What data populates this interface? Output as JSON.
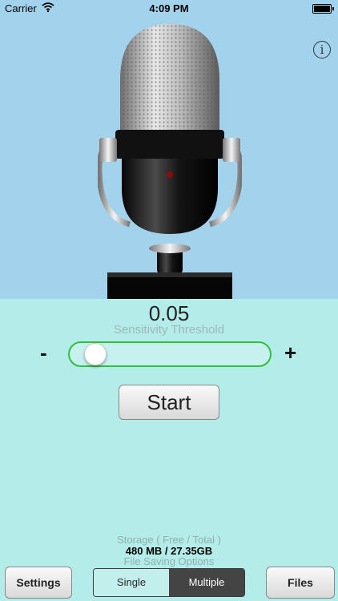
{
  "status": {
    "carrier": "Carrier",
    "time": "4:09 PM"
  },
  "header": {
    "info_icon": "info-icon",
    "mic_image": "microphone-illustration"
  },
  "sensitivity": {
    "value": "0.05",
    "label": "Sensitivity Threshold",
    "minus": "-",
    "plus": "+",
    "slider_fraction": 0.05
  },
  "actions": {
    "start_label": "Start"
  },
  "storage": {
    "label": "Storage ( Free / Total )",
    "value": "480 MB / 27.35GB"
  },
  "file_saving": {
    "label": "File Saving Options",
    "options": [
      "Single",
      "Multiple"
    ],
    "selected": "Multiple"
  },
  "toolbar": {
    "settings_label": "Settings",
    "files_label": "Files"
  },
  "colors": {
    "hero_bg": "#a3d2ec",
    "main_bg": "#b3ece9",
    "slider_border": "#2ec23a"
  }
}
